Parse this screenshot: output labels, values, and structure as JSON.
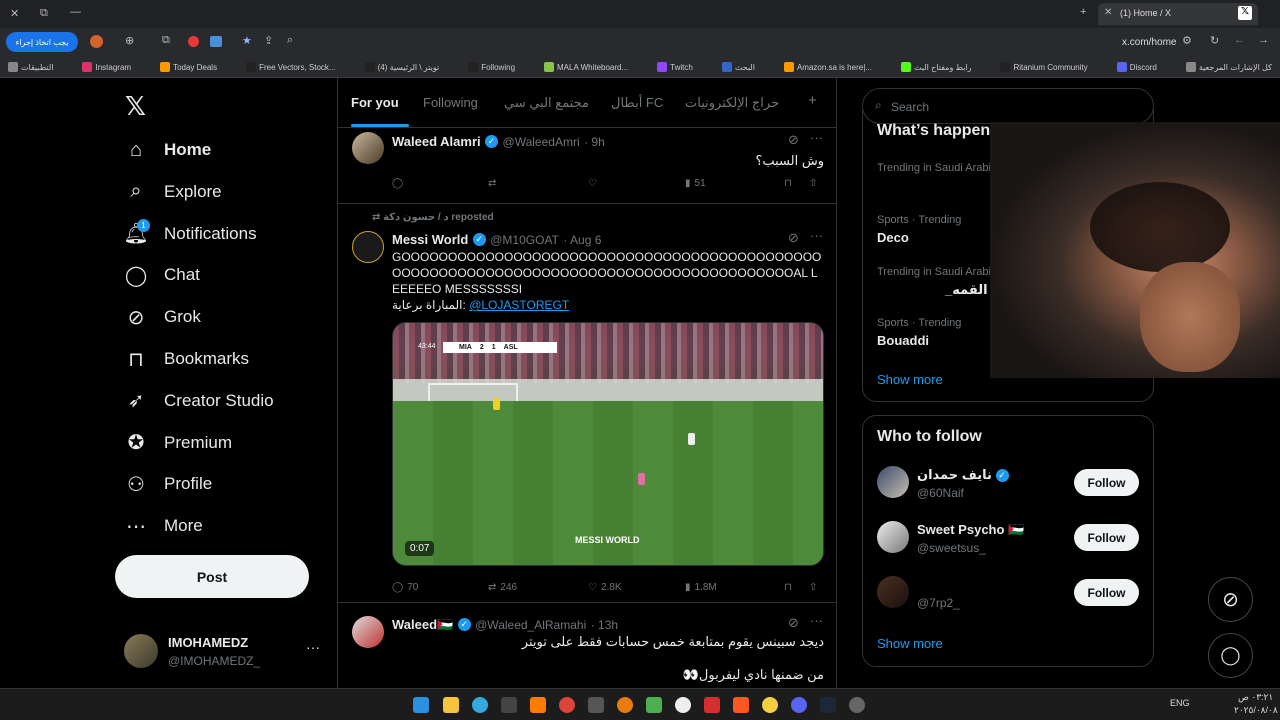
{
  "browser": {
    "tab_title": "(1) Home / X",
    "url": "x.com/home",
    "action_button": "يجب اتخاذ إجراء",
    "bookmarks": [
      {
        "label": "كل الإشارات المرجعية",
        "color": "#888"
      },
      {
        "label": "Discord",
        "color": "#5865f2"
      },
      {
        "label": "Ritanium Community",
        "color": "#222"
      },
      {
        "label": "رابط ومفتاح البث",
        "color": "#53fc18"
      },
      {
        "label": "Amazon.sa is here|...",
        "color": "#ff9900"
      },
      {
        "label": "البحث",
        "color": "#3366cc"
      },
      {
        "label": "Twitch",
        "color": "#9146ff"
      },
      {
        "label": "MALA Whiteboard...",
        "color": "#8bc34a"
      },
      {
        "label": "Following",
        "color": "#222"
      },
      {
        "label": "(4) تويتر \\ الرئيسية",
        "color": "#222"
      },
      {
        "label": "Free Vectors, Stock...",
        "color": "#222"
      },
      {
        "label": "Today Deals",
        "color": "#ff9900"
      },
      {
        "label": "Instagram",
        "color": "#e1306c"
      },
      {
        "label": "التطبيقات",
        "color": "#888"
      }
    ]
  },
  "nav": {
    "items": [
      {
        "label": "Home",
        "icon": "home-icon"
      },
      {
        "label": "Explore",
        "icon": "search-icon"
      },
      {
        "label": "Notifications",
        "icon": "bell-icon",
        "badge": "1"
      },
      {
        "label": "Chat",
        "icon": "chat-icon"
      },
      {
        "label": "Grok",
        "icon": "grok-icon"
      },
      {
        "label": "Bookmarks",
        "icon": "bookmark-icon"
      },
      {
        "label": "Creator Studio",
        "icon": "rocket-icon"
      },
      {
        "label": "Premium",
        "icon": "verified-icon"
      },
      {
        "label": "Profile",
        "icon": "person-icon"
      },
      {
        "label": "More",
        "icon": "more-icon"
      }
    ],
    "post_label": "Post",
    "account": {
      "name": "IMOHAMEDZ",
      "handle": "@IMOHAMEDZ_"
    }
  },
  "feed": {
    "tabs": [
      "For you",
      "Following",
      "مجتمع البي سي",
      "أبطال FC",
      "حراج الإلكترونيات"
    ],
    "tweets": [
      {
        "name": "Waleed Alamri",
        "handle": "@WaleedAmri",
        "time": "· 9h",
        "text": "وش السبب؟",
        "views": "51"
      },
      {
        "repost_by": "د / حسون دكة  reposted",
        "name": "Messi World",
        "handle": "@M10GOAT",
        "time": "· Aug 6",
        "text": "GOOOOOOOOOOOOOOOOOOOOOOOOOOOOOOOOOOOOOOOOOOOOOOOOOOOOOOOOOOOOOOOOOOOOOOOOOOOOOOOOOOOOOOOOAL LEEEEEO MESSSSSSSI",
        "sponsor_text": "المباراة برعاية:",
        "sponsor_link": "@LOJASTOREGT",
        "video": {
          "duration": "0:07",
          "watermark": "MESSI WORLD",
          "clock": "43:44",
          "home": "MIA",
          "home_score": "2",
          "away_score": "1",
          "away": "ASL"
        },
        "replies": "70",
        "reposts": "246",
        "likes": "2.8K",
        "views": "1.8M"
      },
      {
        "name": "Waleed🇵🇸",
        "handle": "@Waleed_AlRamahi",
        "time": "· 13h",
        "text": "ديجد سبينس يقوم بمتابعة خمس حسابات فقط على تويتر",
        "text2": "من ضمنها نادي ليفربول👀"
      }
    ]
  },
  "sidebar": {
    "search_placeholder": "Search",
    "trends_title": "What’s happening",
    "trends": [
      {
        "context": "Trending in Saudi Arabia",
        "topic": ""
      },
      {
        "context": "Sports · Trending",
        "topic": "Deco"
      },
      {
        "context": "Trending in Saudi Arabia",
        "topic": "_القمه"
      },
      {
        "context": "Sports · Trending",
        "topic": "Bouaddi"
      }
    ],
    "show_more": "Show more",
    "who_to_follow_title": "Who to follow",
    "follow_label": "Follow",
    "suggestions": [
      {
        "name": "نايف حمدان",
        "handle": "@60Naif"
      },
      {
        "name": "Sweet Psycho 🇵🇸",
        "handle": "@sweetsus_"
      },
      {
        "name": "",
        "handle": "@7rp2_"
      }
    ]
  },
  "taskbar": {
    "lang": "ENG",
    "time": "٠٣:٢١ ص",
    "date": "٢٠٢٥/٠٨/٠٨"
  },
  "colors": {
    "accent": "#1d9bf0",
    "background": "#000000",
    "border": "#2f3336",
    "muted": "#71767b"
  }
}
